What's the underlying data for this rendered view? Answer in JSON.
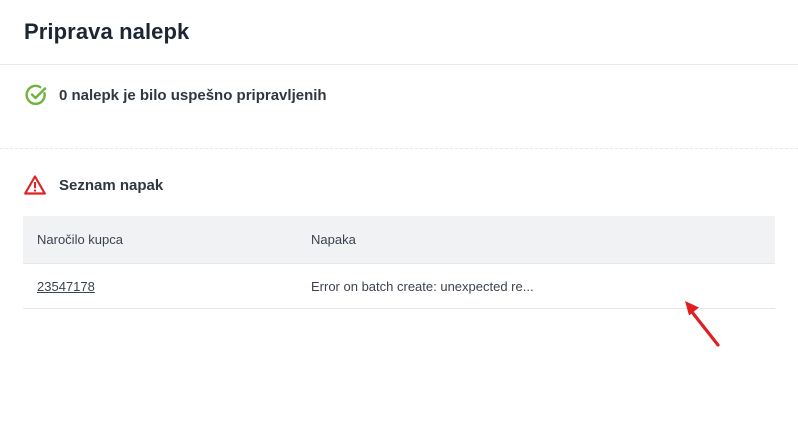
{
  "modal": {
    "title": "Priprava nalepk"
  },
  "success": {
    "icon": "check-circle-icon",
    "color": "#6cb33f",
    "text": "0 nalepk je bilo uspešno pripravljenih"
  },
  "errors": {
    "icon": "warning-triangle-icon",
    "color": "#e02424",
    "title": "Seznam napak",
    "table": {
      "columns": [
        "Naročilo kupca",
        "Napaka"
      ],
      "rows": [
        {
          "order": "23547178",
          "error": "Error on batch create: unexpected re..."
        }
      ]
    }
  },
  "annotation": {
    "icon": "red-arrow-annotation",
    "color": "#e02020"
  }
}
